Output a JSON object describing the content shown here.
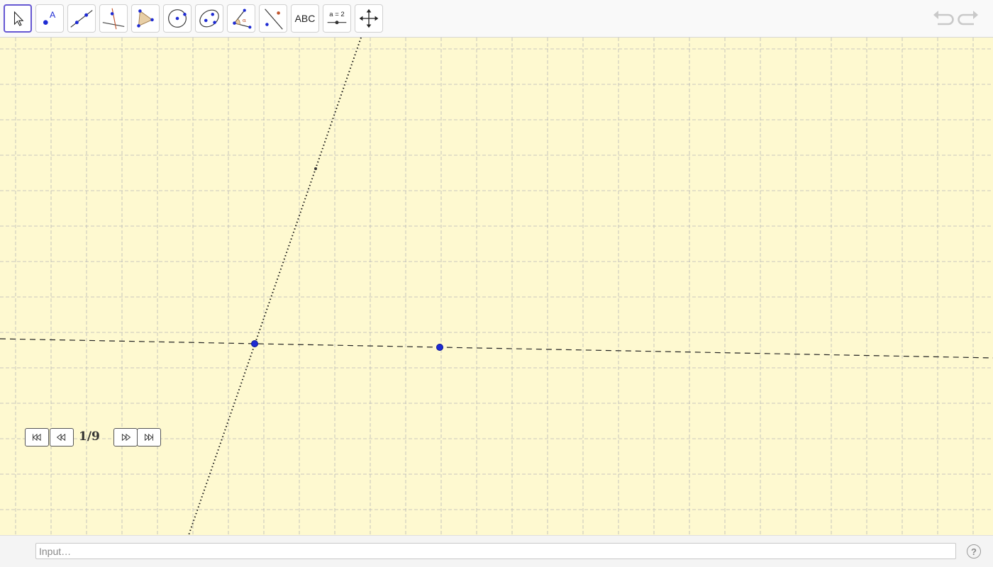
{
  "toolbar": {
    "tools": [
      {
        "name": "move-tool",
        "icon": "pointer-arrow-icon",
        "selected": true
      },
      {
        "name": "point-tool",
        "icon": "point-icon",
        "label": "A"
      },
      {
        "name": "line-tool",
        "icon": "line-through-points-icon"
      },
      {
        "name": "perpendicular-line-tool",
        "icon": "perpendicular-line-icon"
      },
      {
        "name": "polygon-tool",
        "icon": "polygon-icon"
      },
      {
        "name": "circle-tool",
        "icon": "circle-center-point-icon"
      },
      {
        "name": "ellipse-tool",
        "icon": "ellipse-icon"
      },
      {
        "name": "angle-tool",
        "icon": "angle-icon",
        "label": "α"
      },
      {
        "name": "reflect-tool",
        "icon": "reflect-about-line-icon"
      },
      {
        "name": "text-tool",
        "icon": "text-icon",
        "label": "ABC"
      },
      {
        "name": "slider-tool",
        "icon": "slider-icon",
        "label": "a = 2"
      },
      {
        "name": "move-graphics-view-tool",
        "icon": "move-arrows-icon"
      }
    ],
    "undo_icon": "undo-icon",
    "redo_icon": "redo-icon"
  },
  "navigation": {
    "counter": "1/9",
    "buttons": [
      "first-step-icon",
      "previous-step-icon",
      "next-step-icon",
      "last-step-icon"
    ]
  },
  "input_bar": {
    "placeholder": "Input…",
    "help_label": "?"
  },
  "colors": {
    "canvas_background": "#fef9d0",
    "grid_line": "#b8b8b8",
    "point": "#1e2bd3",
    "selected_tool_border": "#6557d2"
  }
}
